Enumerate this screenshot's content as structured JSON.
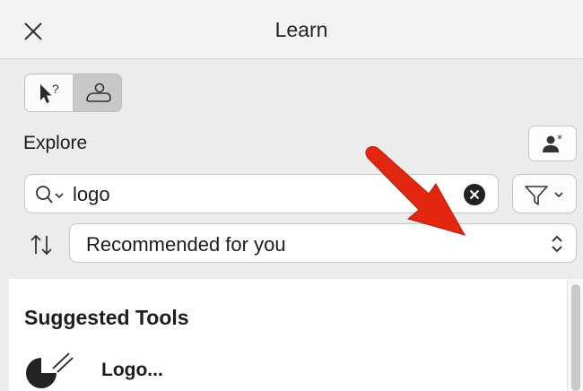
{
  "window": {
    "title": "Learn"
  },
  "toolbar": {
    "modes": [
      {
        "icon": "cursor-question-icon",
        "selected": false
      },
      {
        "icon": "person-cloud-icon",
        "selected": true
      }
    ],
    "user_button_icon": "user-star-icon"
  },
  "explore": {
    "label": "Explore",
    "search": {
      "value": "logo",
      "icon": "search-dropdown-icon",
      "clear_icon": "clear-circle-icon"
    },
    "filter_icon": "funnel-dropdown-icon",
    "sort": {
      "icon": "sort-arrows-icon",
      "selected": "Recommended for you",
      "chevron_icon": "updown-chevron-icon"
    }
  },
  "content": {
    "heading": "Suggested Tools",
    "items": [
      {
        "label": "Logo...",
        "icon": "logo-tool-icon"
      }
    ]
  },
  "colors": {
    "background": "#ececec",
    "content_background": "#ffffff",
    "annotation_arrow": "#e3260f",
    "selected_mode": "#c8c8c8"
  }
}
